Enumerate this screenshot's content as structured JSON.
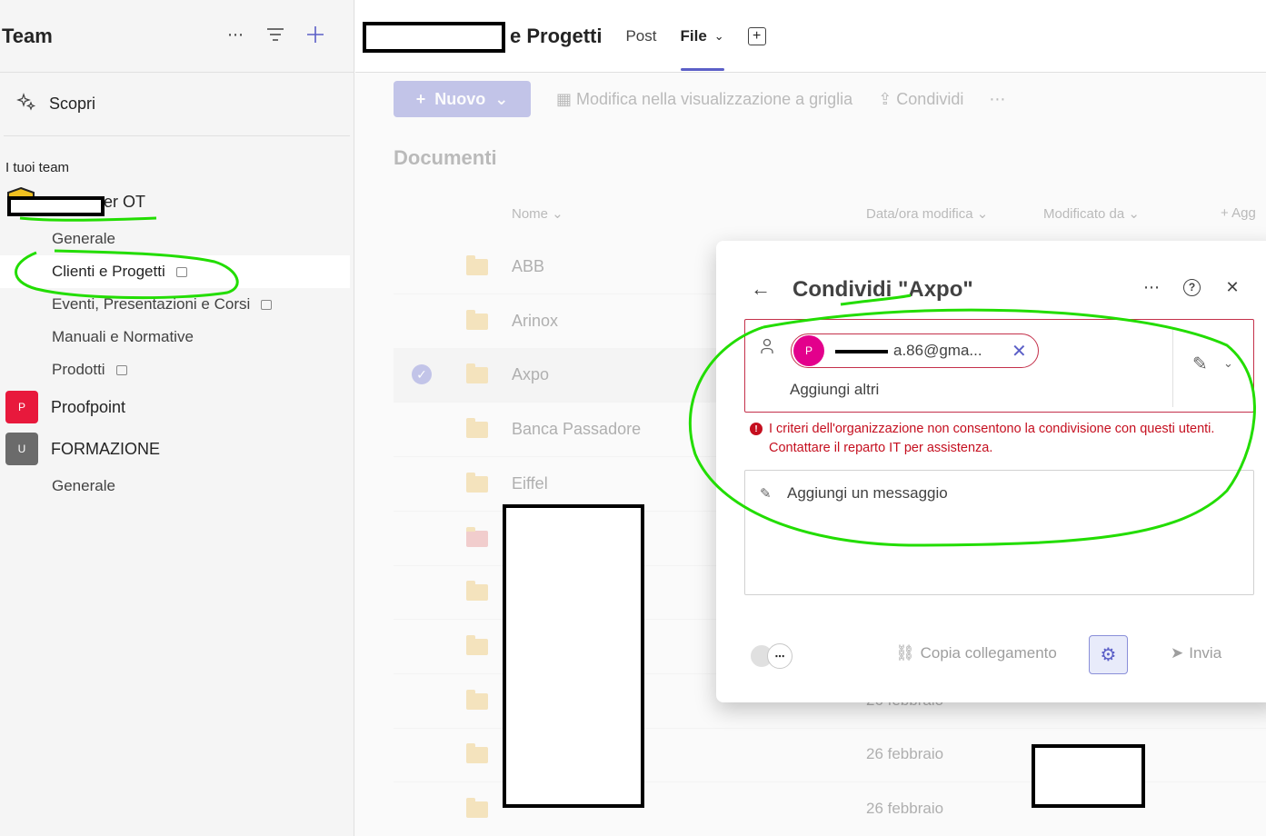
{
  "sidebar": {
    "title": "Team",
    "discover": "Scopri",
    "section": "I tuoi team",
    "teams": [
      {
        "name": "er OT",
        "channels": [
          "Generale",
          "Clienti e Progetti",
          "Eventi, Presentazioni e Corsi",
          "Manuali e Normative",
          "Prodotti"
        ]
      },
      {
        "name": "Proofpoint",
        "initial": "P",
        "color": "#e8193c"
      },
      {
        "name": "FORMAZIONE",
        "initial": "U",
        "color": "#6b6b6b",
        "channels": [
          "Generale"
        ]
      }
    ]
  },
  "topbar": {
    "title": "e Progetti",
    "tabs": [
      "Post",
      "File"
    ]
  },
  "main": {
    "toolbar": {
      "new_label": "Nuovo",
      "grid_label": "Modifica nella visualizzazione a griglia",
      "share_label": "Condividi"
    },
    "doc_title": "Documenti",
    "columns": {
      "name": "Nome",
      "modified": "Data/ora modifica",
      "modified_by": "Modificato da",
      "add": "+ Agg"
    },
    "rows": [
      {
        "name": "ABB",
        "date": ""
      },
      {
        "name": "Arinox",
        "date": ""
      },
      {
        "name": "Axpo",
        "date": "",
        "selected": true
      },
      {
        "name": "Banca Passadore",
        "date": ""
      },
      {
        "name": "Eiffel",
        "date": ""
      },
      {
        "name": "",
        "date": ""
      },
      {
        "name": "",
        "date": ""
      },
      {
        "name": "",
        "date": ""
      },
      {
        "name": "",
        "date": "26 febbraio"
      },
      {
        "name": "",
        "date": "26 febbraio"
      },
      {
        "name": "",
        "date": "26 febbraio"
      }
    ]
  },
  "dialog": {
    "title": "Condividi \"Axpo\"",
    "recipient_initial": "P",
    "recipient_email": "a.86@gma...",
    "add_others": "Aggiungi altri",
    "error": "I criteri dell'organizzazione non consentono la condivisione con questi utenti. Contattare il reparto IT per assistenza.",
    "message_placeholder": "Aggiungi un messaggio",
    "copy_link": "Copia collegamento",
    "send": "Invia"
  }
}
